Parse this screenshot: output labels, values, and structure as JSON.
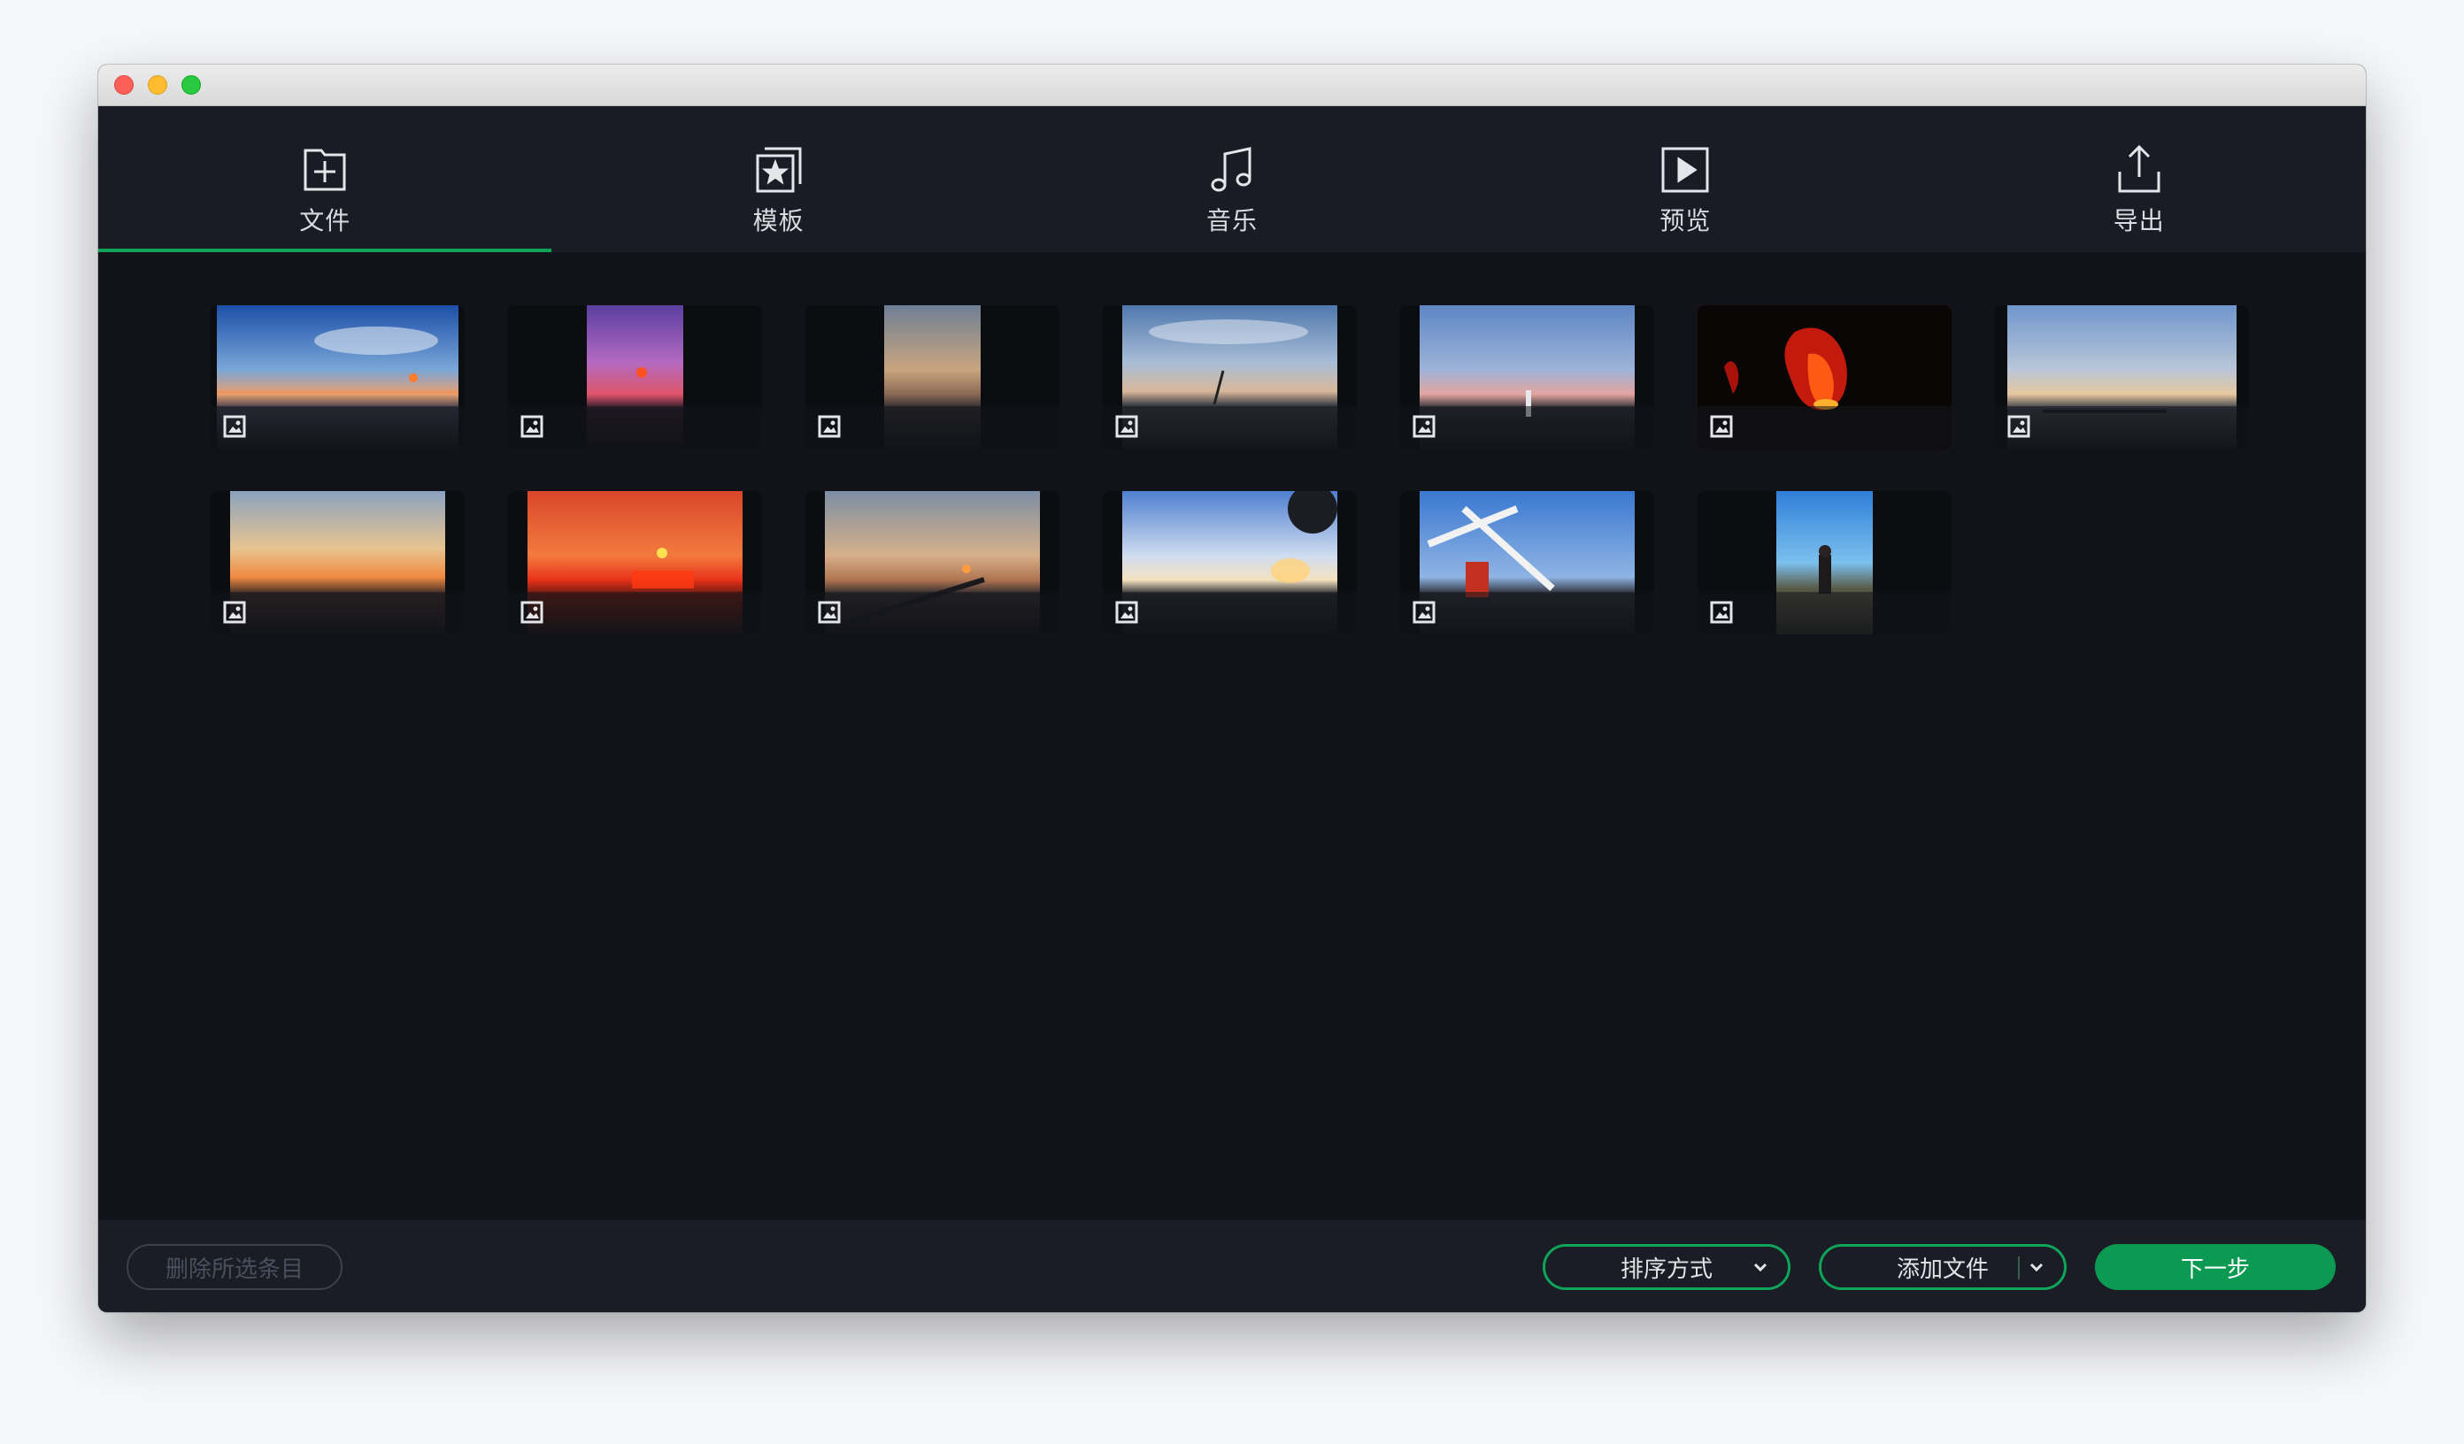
{
  "window": {
    "controls": [
      "close",
      "minimize",
      "zoom"
    ]
  },
  "tabs": [
    {
      "label": "文件",
      "icon": "folder-add-icon",
      "active": true
    },
    {
      "label": "模板",
      "icon": "template-star-icon",
      "active": false
    },
    {
      "label": "音乐",
      "icon": "music-note-icon",
      "active": false
    },
    {
      "label": "预览",
      "icon": "play-preview-icon",
      "active": false
    },
    {
      "label": "导出",
      "icon": "export-upload-icon",
      "active": false
    }
  ],
  "media": [
    {
      "kind": "image",
      "scene": "sunset-blue-sky",
      "fit": "wide"
    },
    {
      "kind": "image",
      "scene": "purple-sunset-sea",
      "fit": "narrow"
    },
    {
      "kind": "image",
      "scene": "dusk-horizon",
      "fit": "narrow"
    },
    {
      "kind": "image",
      "scene": "cloudy-evening-reeds",
      "fit": "wide"
    },
    {
      "kind": "image",
      "scene": "dusk-person-field",
      "fit": "wide"
    },
    {
      "kind": "image",
      "scene": "fire-red",
      "fit": "wide"
    },
    {
      "kind": "image",
      "scene": "pale-sunset-pier",
      "fit": "wide"
    },
    {
      "kind": "image",
      "scene": "golden-sunset-sea",
      "fit": "wide"
    },
    {
      "kind": "image",
      "scene": "red-sunset-reflection",
      "fit": "wide"
    },
    {
      "kind": "image",
      "scene": "sunset-long-pier",
      "fit": "wide"
    },
    {
      "kind": "image",
      "scene": "backlit-coast-tree",
      "fit": "wide"
    },
    {
      "kind": "image",
      "scene": "windmill-blue-sky",
      "fit": "wide"
    },
    {
      "kind": "image",
      "scene": "woman-blue-sky",
      "fit": "narrow"
    }
  ],
  "footer": {
    "delete_label": "删除所选条目",
    "sort_label": "排序方式",
    "add_label": "添加文件",
    "next_label": "下一步"
  },
  "colors": {
    "accent": "#10a35a",
    "background": "#121318",
    "toolbar": "#191c24"
  }
}
